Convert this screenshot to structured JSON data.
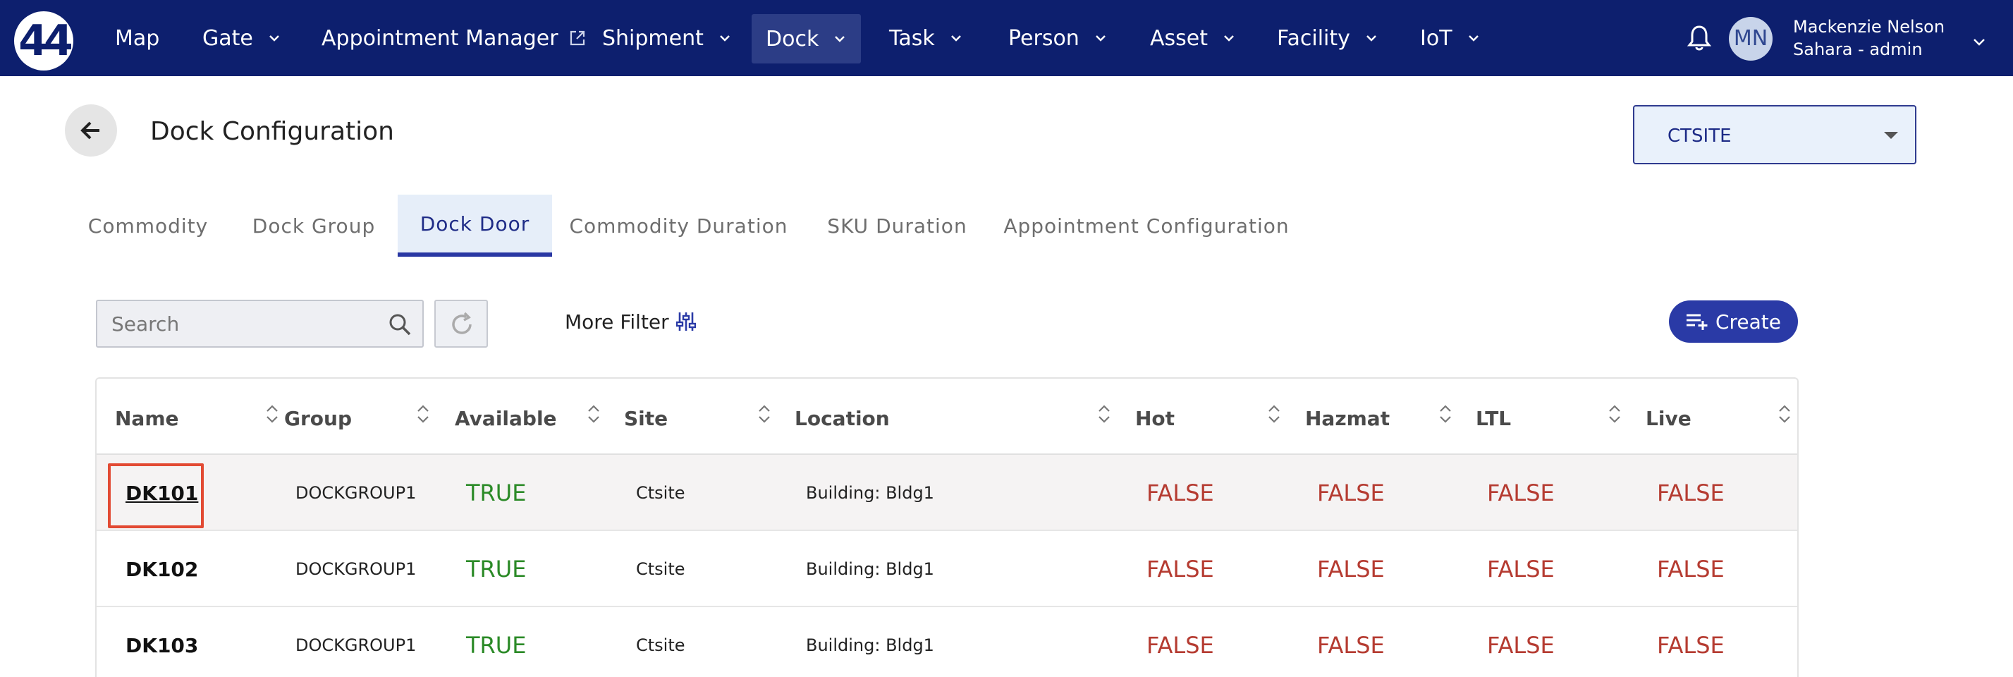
{
  "nav": {
    "logo_text": "44",
    "items": [
      {
        "label": "Map",
        "dropdown": false,
        "external": false,
        "active": false
      },
      {
        "label": "Gate",
        "dropdown": true,
        "external": false,
        "active": false
      },
      {
        "label": "Appointment Manager",
        "dropdown": false,
        "external": true,
        "active": false
      },
      {
        "label": "Shipment",
        "dropdown": true,
        "external": false,
        "active": false
      },
      {
        "label": "Dock",
        "dropdown": true,
        "external": false,
        "active": true
      },
      {
        "label": "Task",
        "dropdown": true,
        "external": false,
        "active": false
      },
      {
        "label": "Person",
        "dropdown": true,
        "external": false,
        "active": false
      },
      {
        "label": "Asset",
        "dropdown": true,
        "external": false,
        "active": false
      },
      {
        "label": "Facility",
        "dropdown": true,
        "external": false,
        "active": false
      },
      {
        "label": "IoT",
        "dropdown": true,
        "external": false,
        "active": false
      }
    ],
    "user": {
      "initials": "MN",
      "name": "Mackenzie Nelson",
      "role": "Sahara - admin"
    }
  },
  "header": {
    "title": "Dock Configuration",
    "site_select": "CTSITE"
  },
  "tabs": [
    {
      "label": "Commodity",
      "active": false
    },
    {
      "label": "Dock Group",
      "active": false
    },
    {
      "label": "Dock Door",
      "active": true
    },
    {
      "label": "Commodity Duration",
      "active": false
    },
    {
      "label": "SKU Duration",
      "active": false
    },
    {
      "label": "Appointment Configuration",
      "active": false
    }
  ],
  "toolbar": {
    "search_placeholder": "Search",
    "more_filter_label": "More Filter",
    "create_label": "Create"
  },
  "table": {
    "columns": [
      "Name",
      "Group",
      "Available",
      "Site",
      "Location",
      "Hot",
      "Hazmat",
      "LTL",
      "Live"
    ],
    "rows": [
      {
        "name": "DK101",
        "group": "DOCKGROUP1",
        "available": "TRUE",
        "site": "Ctsite",
        "location": "Building: Bldg1",
        "hot": "FALSE",
        "hazmat": "FALSE",
        "ltl": "FALSE",
        "live": "FALSE",
        "highlighted": true
      },
      {
        "name": "DK102",
        "group": "DOCKGROUP1",
        "available": "TRUE",
        "site": "Ctsite",
        "location": "Building: Bldg1",
        "hot": "FALSE",
        "hazmat": "FALSE",
        "ltl": "FALSE",
        "live": "FALSE",
        "highlighted": false
      },
      {
        "name": "DK103",
        "group": "DOCKGROUP1",
        "available": "TRUE",
        "site": "Ctsite",
        "location": "Building: Bldg1",
        "hot": "FALSE",
        "hazmat": "FALSE",
        "ltl": "FALSE",
        "live": "FALSE",
        "highlighted": false
      }
    ]
  },
  "colors": {
    "nav_bg": "#0d1f6e",
    "accent": "#2a3aa6",
    "true_green": "#2b8a27",
    "false_red": "#b53b31",
    "highlight_box": "#e24a33"
  }
}
